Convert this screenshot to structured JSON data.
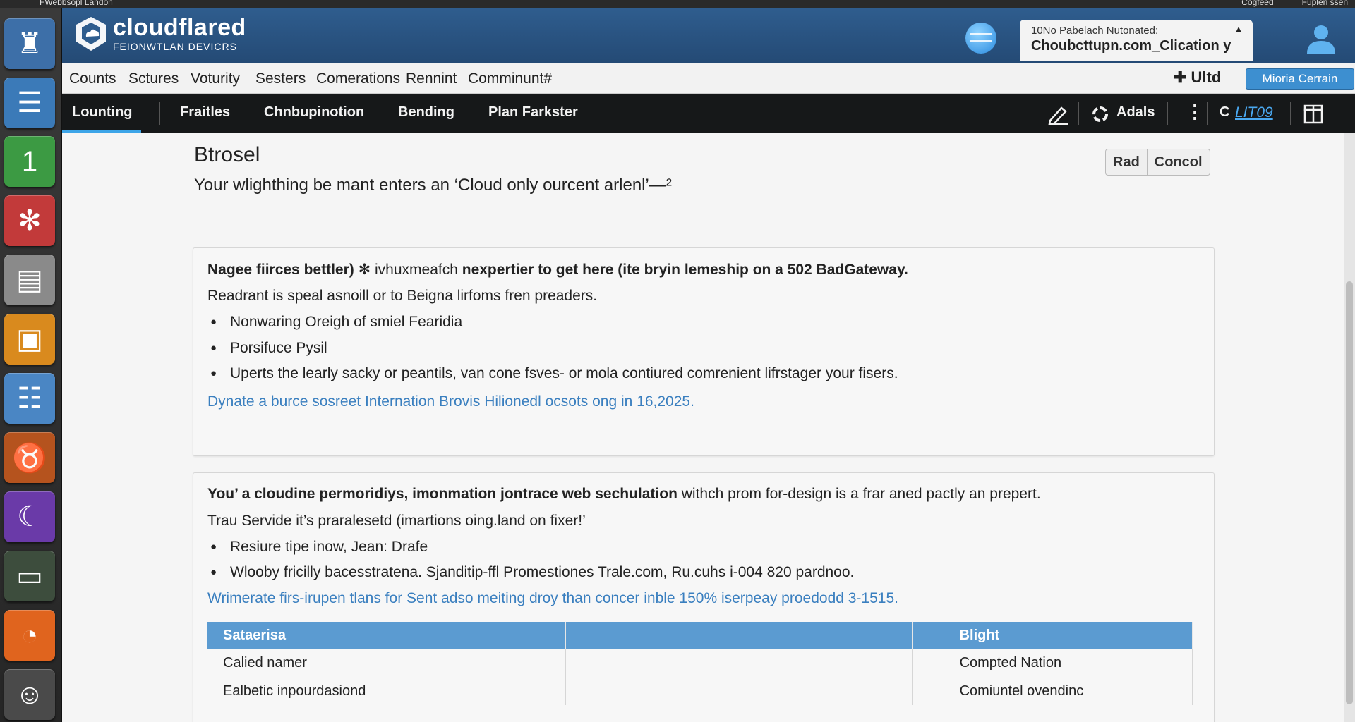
{
  "os_bar": {
    "title": "FWebbsopl Landon",
    "right_items": [
      "Cogfeed",
      "Fuplen ssen"
    ]
  },
  "dock": {
    "items": [
      {
        "name": "lighthouse-app-icon",
        "glyph": "♜",
        "color": "#3d6fa8"
      },
      {
        "name": "database-app-icon",
        "glyph": "☰",
        "color": "#3b7ab8"
      },
      {
        "name": "spreadsheet-app-icon",
        "glyph": "1",
        "color": "#3c9a43"
      },
      {
        "name": "red-app-icon",
        "glyph": "✻",
        "color": "#c23a3a"
      },
      {
        "name": "scanner-app-icon",
        "glyph": "▤",
        "color": "#8a8a8a"
      },
      {
        "name": "image-editor-app-icon",
        "glyph": "▣",
        "color": "#d98a1e"
      },
      {
        "name": "notepad-app-icon",
        "glyph": "☷",
        "color": "#4a86c4"
      },
      {
        "name": "beast-app-icon",
        "glyph": "♉",
        "color": "#b5531e"
      },
      {
        "name": "moon-app-icon",
        "glyph": "☾",
        "color": "#6a3aa8"
      },
      {
        "name": "terminal-app-icon",
        "glyph": "▭",
        "color": "#3d4d3d"
      },
      {
        "name": "rss-app-icon",
        "glyph": "◔",
        "color": "#e0641e"
      },
      {
        "name": "user-account-icon",
        "glyph": "☺",
        "color": "#4a4a4a"
      }
    ]
  },
  "brand": {
    "name": "cloudflared",
    "subtitle": "FEIONWTLAN DEVICRS"
  },
  "notification": {
    "label": "10No Pabelach  Nutonated:",
    "value": "Choubcttupn.com_Clication y"
  },
  "menu": {
    "items": [
      "Counts",
      "Sctures",
      "Voturity",
      "Sesters",
      "Comerations",
      "Rennint",
      "Comminunt#"
    ],
    "add_label": "✚  Ultd",
    "button_label": "Mioria Cerrain"
  },
  "tabs": {
    "items": [
      "Lounting",
      "Fraitles",
      "Chnbupinotion",
      "Bending",
      "Plan Farkster"
    ],
    "action_label": "Adals",
    "link_label": "LIT09",
    "c_label": "C"
  },
  "page": {
    "title": "Btrosel",
    "description": "Your wlighthing be mant enters an ‘Cloud only ourcent arlenl’—²",
    "buttons": [
      "Rad",
      "Concol"
    ]
  },
  "card1": {
    "head_bold": "Nagee fiirces bettler)",
    "head_normal": " ✻ ivhuxmeafch ",
    "head_bold2": "nexpertier to get here (ite bryin lemeship on a 502 BadGateway.",
    "text": "Readrant is speal asnoill or to Beigna lirfoms fren preaders.",
    "bullets": [
      "Nonwaring Oreigh of smiel Fearidia",
      "Porsifuce Pysil",
      "Uperts the learly sacky or peantils, van cone fsves- or mola contiured comrenient lifrstager your fisers."
    ],
    "link": "Dynate a burce sosreet Internation Brovis Hilionedl ocsots ong in 16,2025."
  },
  "card2": {
    "head_bold": "You’ a cloudine permoridiys, imonmation jontrace web sechulation",
    "head_normal": " withch prom for-design is a frar aned pactly an prepert.",
    "text": "Trau Servide it’s praralesetd (imartions oing.land on fixer!’",
    "bullets": [
      "Resiure tipe inow, Jean: Drafe",
      "Wlooby fricilly bacesstratena. Sjanditip-ffl Promestiones Trale.com, Ru.cuhs i-004 820 pardnoo."
    ],
    "link": "Wrimerate firs-irupen tlans for Sent adso meiting droy than concer inble 150% iserpeay proedodd 3-1515."
  },
  "table": {
    "headers": [
      "Sataerisa",
      "",
      "",
      "Blight"
    ],
    "rows": [
      [
        "Calied namer",
        "",
        "",
        "Compted Nation"
      ],
      [
        "Ealbetic inpourdasiond",
        "",
        "",
        "Comiuntel ovendinc"
      ]
    ]
  }
}
